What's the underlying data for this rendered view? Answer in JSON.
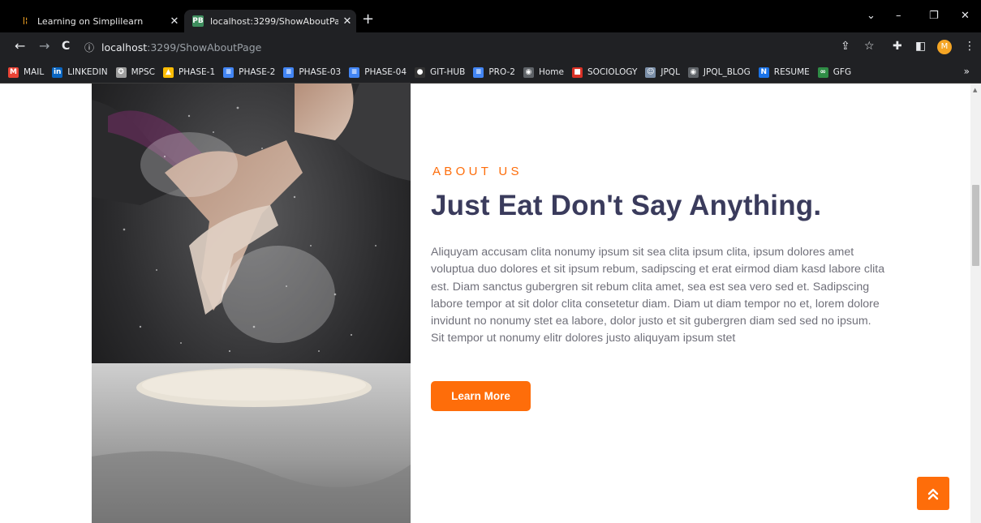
{
  "browser": {
    "tabs": [
      {
        "title": "Learning on Simplilearn",
        "favicon": "simplilearn-icon",
        "active": false
      },
      {
        "title": "localhost:3299/ShowAboutPage",
        "favicon": "PB",
        "active": true
      }
    ],
    "new_tab": "+",
    "window_controls": {
      "minimize": "–",
      "restore": "❐",
      "close": "✕",
      "tab_search": "⌄"
    },
    "nav": {
      "back": "←",
      "forward": "→",
      "reload": "C"
    },
    "address": {
      "host": "localhost",
      "path": ":3299/ShowAboutPage"
    },
    "profile_initial": "M",
    "bookmarks": [
      {
        "label": "MAIL",
        "icon": "gmail-icon",
        "glyph": "M",
        "color": "#ea4335"
      },
      {
        "label": "LINKEDIN",
        "icon": "linkedin-icon",
        "glyph": "in",
        "color": "#0a66c2"
      },
      {
        "label": "MPSC",
        "icon": "emblem-icon",
        "glyph": "✪",
        "color": "#9e9e9e"
      },
      {
        "label": "PHASE-1",
        "icon": "drive-icon",
        "glyph": "▲",
        "color": "#fbbc04"
      },
      {
        "label": "PHASE-2",
        "icon": "docs-icon",
        "glyph": "≡",
        "color": "#4285f4"
      },
      {
        "label": "PHASE-03",
        "icon": "docs-icon",
        "glyph": "≡",
        "color": "#4285f4"
      },
      {
        "label": "PHASE-04",
        "icon": "docs-icon",
        "glyph": "≡",
        "color": "#4285f4"
      },
      {
        "label": "GIT-HUB",
        "icon": "github-icon",
        "glyph": "●",
        "color": "#333333"
      },
      {
        "label": "PRO-2",
        "icon": "docs-icon",
        "glyph": "≡",
        "color": "#4285f4"
      },
      {
        "label": "Home",
        "icon": "globe-icon",
        "glyph": "◉",
        "color": "#5f6368"
      },
      {
        "label": "SOCIOLOGY",
        "icon": "red-square-icon",
        "glyph": "■",
        "color": "#d93025"
      },
      {
        "label": "JPQL",
        "icon": "person-icon",
        "glyph": "☺",
        "color": "#7b8fa8"
      },
      {
        "label": "JPQL_BLOG",
        "icon": "globe-icon",
        "glyph": "◉",
        "color": "#5f6368"
      },
      {
        "label": "RESUME",
        "icon": "n-logo-icon",
        "glyph": "N",
        "color": "#1a73e8"
      },
      {
        "label": "GFG",
        "icon": "gfg-icon",
        "glyph": "∞",
        "color": "#2f8d46"
      }
    ],
    "bookmarks_more": "»"
  },
  "about": {
    "eyebrow": "ABOUT US",
    "heading": "Just Eat Don't Say Anything.",
    "body": "Aliquyam accusam clita nonumy ipsum sit sea clita ipsum clita, ipsum dolores amet voluptua duo dolores et sit ipsum rebum, sadipscing et erat eirmod diam kasd labore clita est. Diam sanctus gubergren sit rebum clita amet, sea est sea vero sed et. Sadipscing labore tempor at sit dolor clita consetetur diam. Diam ut diam tempor no et, lorem dolore invidunt no nonumy stet ea labore, dolor justo et sit gubergren diam sed sed no ipsum. Sit tempor ut nonumy elitr dolores justo aliquyam ipsum stet",
    "button_label": "Learn More"
  },
  "colors": {
    "accent": "#fe6d0a",
    "heading": "#3a3b5c",
    "body": "#70707a"
  }
}
